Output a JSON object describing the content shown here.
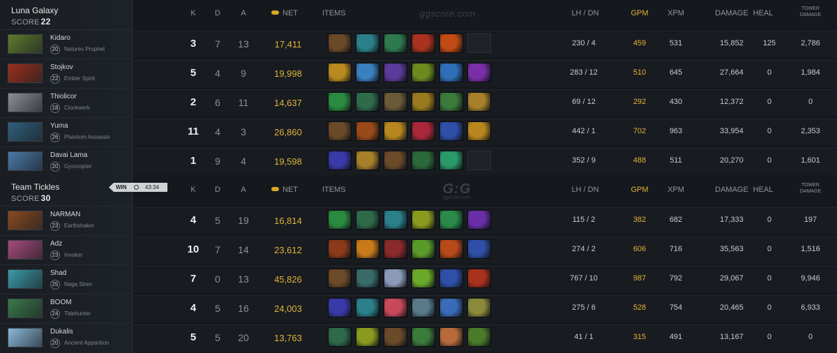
{
  "headers": {
    "k": "K",
    "d": "D",
    "a": "A",
    "net": "NET",
    "items": "ITEMS",
    "lh_dn": "LH  /  DN",
    "gpm": "GPM",
    "xpm": "XPM",
    "damage": "DAMAGE",
    "heal": "HEAL",
    "tower_damage": "TOWER\nDAMAGE"
  },
  "watermark_top": "ggscore.com",
  "watermark_mid": {
    "big": "G:G",
    "small": "ggscore.com"
  },
  "match_result": {
    "label": "WIN",
    "time": "43:34"
  },
  "colors": {
    "gold": "#e0b338",
    "background": "#15191e",
    "row": "#181c21"
  },
  "teams": [
    {
      "name": "Luna Galaxy",
      "score_label": "SCORE",
      "score": "22",
      "players": [
        {
          "name": "Kidaro",
          "level": "20",
          "hero": "Natures Prophet",
          "portrait": "#5e7a2e",
          "k": "3",
          "d": "7",
          "a": "13",
          "net": "17,411",
          "lh_dn": "230  /  4",
          "gpm": "459",
          "xpm": "531",
          "damage": "15,852",
          "heal": "125",
          "tower_damage": "2,786",
          "items": [
            "#6b4a2a",
            "#2a7f8a",
            "#2f7a4d",
            "#a8321e",
            "#c24a14",
            "empty"
          ]
        },
        {
          "name": "Stojkov",
          "level": "22",
          "hero": "Ember Spirit",
          "portrait": "#9a2f1a",
          "k": "5",
          "d": "4",
          "a": "9",
          "net": "19,998",
          "lh_dn": "283  /  12",
          "gpm": "510",
          "xpm": "645",
          "damage": "27,664",
          "heal": "0",
          "tower_damage": "1,984",
          "items": [
            "#b98a1f",
            "#3a7fbf",
            "#5a3a9a",
            "#6d8a1e",
            "#2f6fb8",
            "#7a2fa8"
          ]
        },
        {
          "name": "Thiolicor",
          "level": "18",
          "hero": "Clockwerk",
          "portrait": "#8a8f96",
          "k": "2",
          "d": "6",
          "a": "11",
          "net": "14,637",
          "lh_dn": "69  /  12",
          "gpm": "292",
          "xpm": "430",
          "damage": "12,372",
          "heal": "0",
          "tower_damage": "0",
          "items": [
            "#2a8a3f",
            "#2f6a4a",
            "#6a5a3a",
            "#9a7a1f",
            "#3a7a3a",
            "#a8802a"
          ]
        },
        {
          "name": "Yuma",
          "level": "26",
          "hero": "Phantom Assassin",
          "portrait": "#2f5f7a",
          "k": "11",
          "d": "4",
          "a": "3",
          "net": "26,860",
          "lh_dn": "442  /  1",
          "gpm": "702",
          "xpm": "963",
          "damage": "33,954",
          "heal": "0",
          "tower_damage": "2,353",
          "items": [
            "#6b4a2a",
            "#9a4a1a",
            "#b8861f",
            "#a8283a",
            "#2f4fa8",
            "#b8861f"
          ]
        },
        {
          "name": "Davai Lama",
          "level": "20",
          "hero": "Gyrocopter",
          "portrait": "#4a7aa8",
          "k": "1",
          "d": "9",
          "a": "4",
          "net": "19,598",
          "lh_dn": "352  /  9",
          "gpm": "488",
          "xpm": "511",
          "damage": "20,270",
          "heal": "0",
          "tower_damage": "1,601",
          "items": [
            "#3a3aa8",
            "#a8802a",
            "#6b4a2a",
            "#2a6a3a",
            "#2a9a6a",
            "empty"
          ]
        }
      ]
    },
    {
      "name": "Team Tickles",
      "score_label": "SCORE",
      "score": "30",
      "players": [
        {
          "name": "NARMAN",
          "level": "23",
          "hero": "Earthshaker",
          "portrait": "#8a4a1f",
          "k": "4",
          "d": "5",
          "a": "19",
          "net": "16,814",
          "lh_dn": "115  /  2",
          "gpm": "382",
          "xpm": "682",
          "damage": "17,333",
          "heal": "0",
          "tower_damage": "197",
          "items": [
            "#2a8a3f",
            "#2f6a4a",
            "#2a7f8a",
            "#8a9a1f",
            "#2a8a4a",
            "#6a2fa8"
          ]
        },
        {
          "name": "Adz",
          "level": "23",
          "hero": "Invoker",
          "portrait": "#a84a7a",
          "k": "10",
          "d": "7",
          "a": "14",
          "net": "23,612",
          "lh_dn": "274  /  2",
          "gpm": "606",
          "xpm": "716",
          "damage": "35,563",
          "heal": "0",
          "tower_damage": "1,516",
          "items": [
            "#8a3a1a",
            "#c87a1a",
            "#8a2a2a",
            "#5a9a2a",
            "#b84a1a",
            "#2f4fa8"
          ]
        },
        {
          "name": "Shad",
          "level": "25",
          "hero": "Naga Siren",
          "portrait": "#3a9aa8",
          "k": "7",
          "d": "0",
          "a": "13",
          "net": "45,826",
          "lh_dn": "767  /  10",
          "gpm": "987",
          "xpm": "792",
          "damage": "29,067",
          "heal": "0",
          "tower_damage": "9,946",
          "items": [
            "#6b4a2a",
            "#3a6a6a",
            "#8a9ab8",
            "#6aa82a",
            "#2f4fa8",
            "#a8321e"
          ]
        },
        {
          "name": "BOOM",
          "level": "24",
          "hero": "Tidehunter",
          "portrait": "#3a7a4a",
          "k": "4",
          "d": "5",
          "a": "16",
          "net": "24,003",
          "lh_dn": "275  /  6",
          "gpm": "528",
          "xpm": "754",
          "damage": "20,465",
          "heal": "0",
          "tower_damage": "6,933",
          "items": [
            "#3a3aa8",
            "#2a7f8a",
            "#c84a5a",
            "#5a7a8a",
            "#3a6ab8",
            "#8a8a3a"
          ]
        },
        {
          "name": "Dukalis",
          "level": "20",
          "hero": "Ancient Apparition",
          "portrait": "#8ab8d8",
          "k": "5",
          "d": "5",
          "a": "20",
          "net": "13,763",
          "lh_dn": "41  /  1",
          "gpm": "315",
          "xpm": "491",
          "damage": "13,167",
          "heal": "0",
          "tower_damage": "0",
          "items": [
            "#2f6a4a",
            "#8a9a1f",
            "#6b4a2a",
            "#3a7a3a",
            "#b86a3a",
            "#4a7a2a"
          ]
        }
      ]
    }
  ]
}
